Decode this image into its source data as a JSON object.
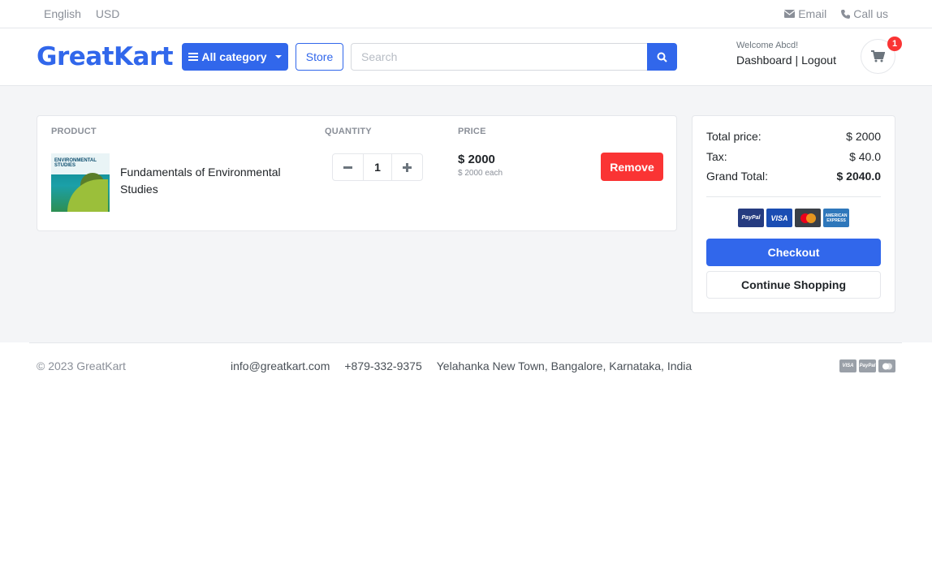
{
  "topbar": {
    "language": "English",
    "currency": "USD",
    "email_label": "Email",
    "call_label": "Call us"
  },
  "header": {
    "logo_part1": "Great",
    "logo_part2": "Kart",
    "category_label": "All category",
    "store_label": "Store",
    "search_placeholder": "Search",
    "welcome": "Welcome Abcd!",
    "dashboard_label": "Dashboard",
    "separator": "|",
    "logout_label": "Logout",
    "cart_count": "1"
  },
  "cart": {
    "col_product": "PRODUCT",
    "col_quantity": "QUANTITY",
    "col_price": "PRICE",
    "items": [
      {
        "thumb_title": "ENVIRONMENTAL STUDIES",
        "name": "Fundamentals of Environmental Studies",
        "quantity": "1",
        "price": "$ 2000",
        "each": "$ 2000 each",
        "remove_label": "Remove"
      }
    ]
  },
  "summary": {
    "total_label": "Total price:",
    "total_value": "$ 2000",
    "tax_label": "Tax:",
    "tax_value": "$ 40.0",
    "grand_label": "Grand Total:",
    "grand_value": "$ 2040.0",
    "payment_icons": [
      "paypal-icon",
      "visa-icon",
      "mastercard-icon",
      "amex-icon"
    ],
    "paypal_text": "PayPal",
    "visa_text": "VISA",
    "amex_text": "AMERICAN EXPRESS",
    "checkout_label": "Checkout",
    "continue_label": "Continue Shopping"
  },
  "footer": {
    "copyright": "© 2023 GreatKart",
    "email": "info@greatkart.com",
    "phone": "+879-332-9375",
    "address": "Yelahanka New Town, Bangalore, Karnataka, India",
    "visa_text": "VISA",
    "paypal_text": "PayPal"
  },
  "colors": {
    "primary": "#3167eb",
    "danger": "#fa3434",
    "background": "#f4f5f7"
  }
}
